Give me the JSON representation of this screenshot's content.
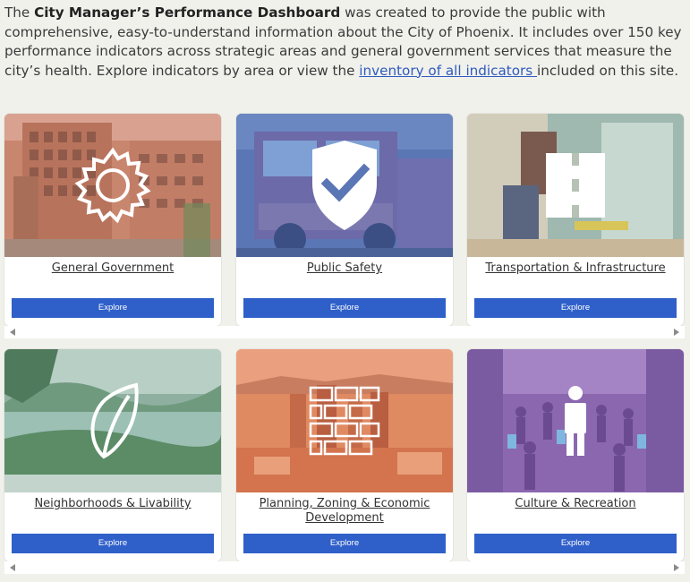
{
  "intro": {
    "text1": "The ",
    "bold": "City Manager’s Performance Dashboard",
    "text2": " was created to provide the public with comprehensive, easy-to-understand information about the City of Phoenix. It includes over 150 key performance indicators across strategic areas and general government services that measure the city’s health. Explore indicators by area or view the ",
    "link": "inventory of all indicators ",
    "text3": "included on this site."
  },
  "cards": [
    {
      "title": "General Government",
      "button": "Explore",
      "icon": "gear-sun-icon"
    },
    {
      "title": "Public Safety",
      "button": "Explore",
      "icon": "shield-check-icon"
    },
    {
      "title": "Transportation & Infrastructure",
      "button": "Explore",
      "icon": "road-icon"
    },
    {
      "title": "Neighborhoods & Livability",
      "button": "Explore",
      "icon": "leaf-icon"
    },
    {
      "title": "Planning, Zoning & Economic Development",
      "button": "Explore",
      "icon": "brick-wall-icon"
    },
    {
      "title": "Culture & Recreation",
      "button": "Explore",
      "icon": "person-icon"
    }
  ],
  "colors": {
    "button": "#2f5fc9",
    "link": "#2f5bbf",
    "background": "#f1f1ec"
  }
}
